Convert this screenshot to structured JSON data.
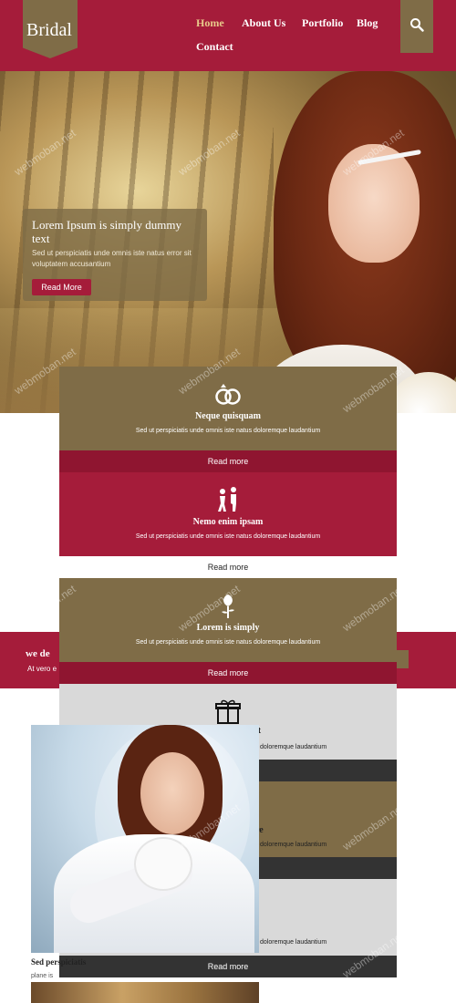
{
  "site": {
    "logo": "Bridal"
  },
  "nav": {
    "items": [
      {
        "label": "Home",
        "active": true
      },
      {
        "label": "About Us",
        "active": false
      },
      {
        "label": "Portfolio",
        "active": false
      },
      {
        "label": "Blog",
        "active": false
      },
      {
        "label": "Contact",
        "active": false
      }
    ],
    "search_icon": "search-icon"
  },
  "hero": {
    "title": "Lorem Ipsum is simply dummy text",
    "text": "Sed ut perspiciatis unde omnis iste natus error sit voluptatem accusantium",
    "button": "Read More"
  },
  "services": [
    {
      "icon": "rings-icon",
      "title": "Neque quisquam",
      "text": "Sed ut perspiciatis unde omnis iste natus doloremque laudantium",
      "button": "Read more"
    },
    {
      "icon": "couple-icon",
      "title": "Nemo enim ipsam",
      "text": "Sed ut perspiciatis unde omnis iste natus doloremque laudantium",
      "button": "Read more"
    },
    {
      "icon": "rose-icon",
      "title": "Lorem is simply",
      "text": "Sed ut perspiciatis unde omnis iste natus doloremque laudantium",
      "button": "Read more"
    },
    {
      "icon": "gift-icon",
      "title": "it",
      "text": "doloremque laudantium"
    },
    {
      "title": "re",
      "text": "doloremque laudantium"
    },
    {
      "title": ".",
      "text": "doloremque laudantium",
      "button": "Read more"
    }
  ],
  "band": {
    "title": "we de",
    "text": "At vero e"
  },
  "gallery": {
    "title": "Sed perspiciatis",
    "subtitle": "plane is"
  },
  "watermark": "webmoban.net",
  "colors": {
    "primary": "#a51c3a",
    "accent": "#7f6c47",
    "light": "#d9d9d9",
    "dark": "#333333"
  }
}
